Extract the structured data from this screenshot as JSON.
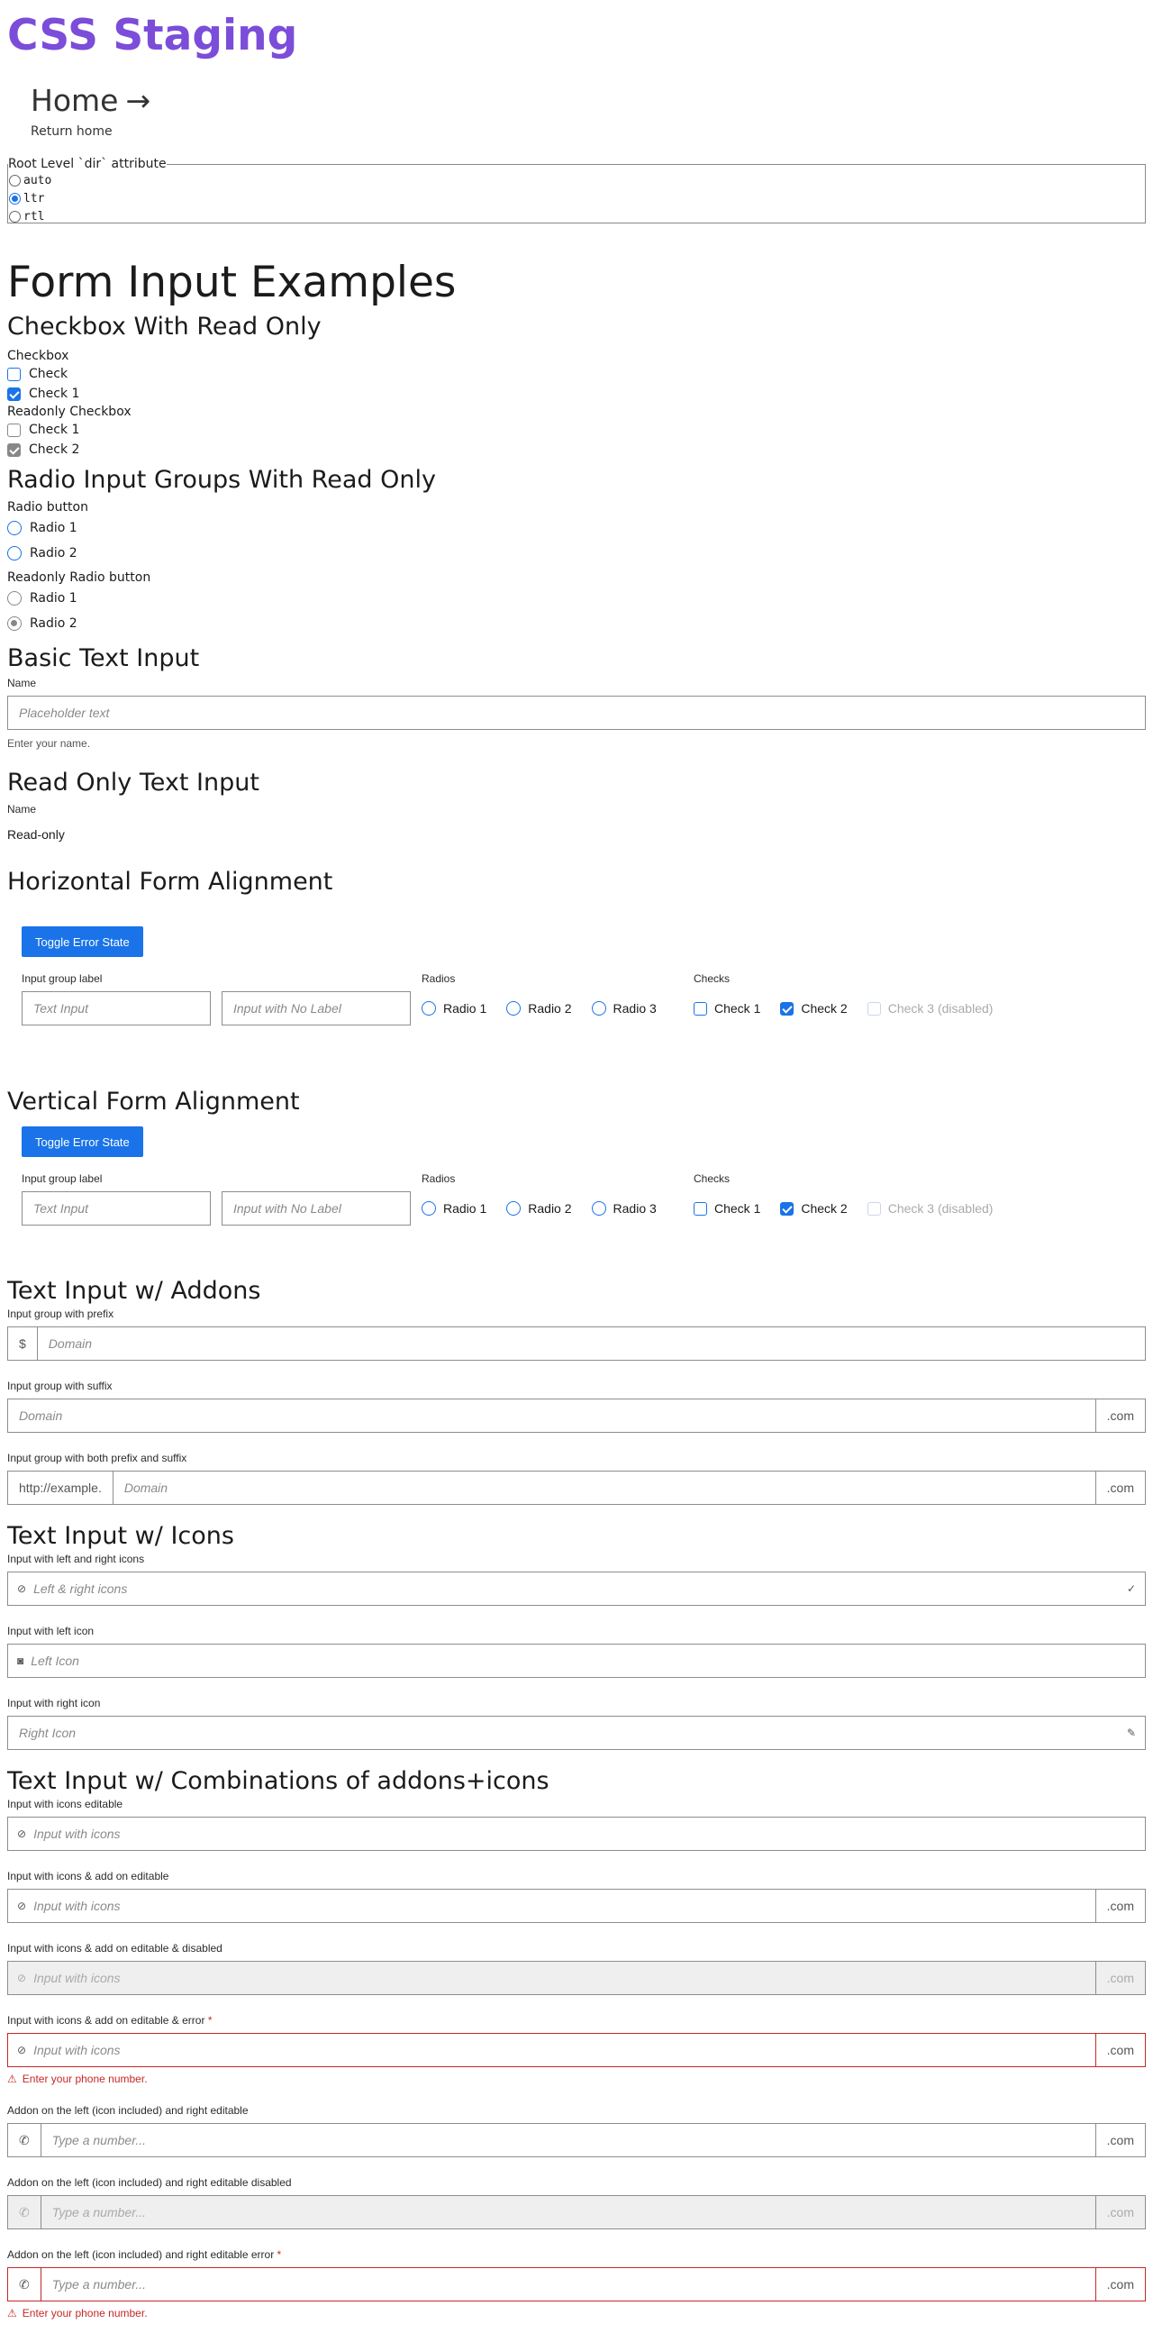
{
  "site": {
    "title": "CSS Staging",
    "home_label": "Home",
    "home_arrow": "→",
    "home_sub": "Return home"
  },
  "dir_control": {
    "legend": "Root Level `dir` attribute",
    "options": [
      {
        "label": "auto",
        "checked": false
      },
      {
        "label": "ltr",
        "checked": true
      },
      {
        "label": "rtl",
        "checked": false
      }
    ]
  },
  "page_title": "Form Input Examples",
  "checkbox_section": {
    "heading": "Checkbox With Read Only",
    "group1_label": "Checkbox",
    "group1": [
      {
        "label": "Check",
        "checked": false
      },
      {
        "label": "Check 1",
        "checked": true
      }
    ],
    "group2_label": "Readonly Checkbox",
    "group2": [
      {
        "label": "Check 1",
        "checked": false
      },
      {
        "label": "Check 2",
        "checked": true
      }
    ]
  },
  "radio_section": {
    "heading": "Radio Input Groups With Read Only",
    "group1_label": "Radio button",
    "group1": [
      {
        "label": "Radio 1",
        "checked": false
      },
      {
        "label": "Radio 2",
        "checked": false
      }
    ],
    "group2_label": "Readonly Radio button",
    "group2": [
      {
        "label": "Radio 1",
        "checked": false
      },
      {
        "label": "Radio 2",
        "checked": true
      }
    ]
  },
  "basic_text": {
    "heading": "Basic Text Input",
    "label": "Name",
    "placeholder": "Placeholder text",
    "hint": "Enter your name."
  },
  "readonly_text": {
    "heading": "Read Only Text Input",
    "label": "Name",
    "value": "Read-only"
  },
  "horizontal": {
    "heading": "Horizontal Form Alignment",
    "button": "Toggle Error State",
    "input_group_label": "Input group label",
    "input1_placeholder": "Text Input",
    "input2_placeholder": "Input with No Label",
    "radios_label": "Radios",
    "radios": [
      "Radio 1",
      "Radio 2",
      "Radio 3"
    ],
    "checks_label": "Checks",
    "checks": [
      {
        "label": "Check 1",
        "checked": false,
        "disabled": false
      },
      {
        "label": "Check 2",
        "checked": true,
        "disabled": false
      },
      {
        "label": "Check 3 (disabled)",
        "checked": false,
        "disabled": true
      }
    ]
  },
  "vertical": {
    "heading": "Vertical Form Alignment",
    "button": "Toggle Error State",
    "input_group_label": "Input group label",
    "input1_placeholder": "Text Input",
    "input2_placeholder": "Input with No Label",
    "radios_label": "Radios",
    "radios": [
      "Radio 1",
      "Radio 2",
      "Radio 3"
    ],
    "checks_label": "Checks",
    "checks": [
      {
        "label": "Check 1",
        "checked": false,
        "disabled": false
      },
      {
        "label": "Check 2",
        "checked": true,
        "disabled": false
      },
      {
        "label": "Check 3 (disabled)",
        "checked": false,
        "disabled": true
      }
    ]
  },
  "addons": {
    "heading": "Text Input w/ Addons",
    "prefix_label": "Input group with prefix",
    "prefix": "$",
    "prefix_placeholder": "Domain",
    "suffix_label": "Input group with suffix",
    "suffix_placeholder": "Domain",
    "suffix": ".com",
    "both_label": "Input group with both prefix and suffix",
    "both_prefix": "http://example.",
    "both_placeholder": "Domain",
    "both_suffix": ".com"
  },
  "icons": {
    "heading": "Text Input w/ Icons",
    "lr_label": "Input with left and right icons",
    "lr_placeholder": "Left & right icons",
    "left_label": "Input with left icon",
    "left_placeholder": "Left Icon",
    "right_label": "Input with right icon",
    "right_placeholder": "Right Icon"
  },
  "combos": {
    "heading": "Text Input w/ Combinations of addons+icons",
    "items": [
      {
        "label": "Input with icons editable",
        "placeholder": "Input with icons",
        "suffix": ""
      },
      {
        "label": "Input with icons & add on editable",
        "placeholder": "Input with icons",
        "suffix": ".com"
      },
      {
        "label": "Input with icons & add on editable & disabled",
        "placeholder": "Input with icons",
        "suffix": ".com"
      },
      {
        "label": "Input with icons & add on editable & error",
        "placeholder": "Input with icons",
        "suffix": ".com",
        "required": "*",
        "error": "Enter your phone number."
      },
      {
        "label": "Addon on the left (icon included) and right editable",
        "placeholder": "Type a number...",
        "suffix": ".com"
      },
      {
        "label": "Addon on the left (icon included) and right editable disabled",
        "placeholder": "Type a number...",
        "suffix": ".com"
      },
      {
        "label": "Addon on the left (icon included) and right editable error",
        "placeholder": "Type a number...",
        "suffix": ".com",
        "required": "*",
        "error": "Enter your phone number."
      }
    ]
  }
}
